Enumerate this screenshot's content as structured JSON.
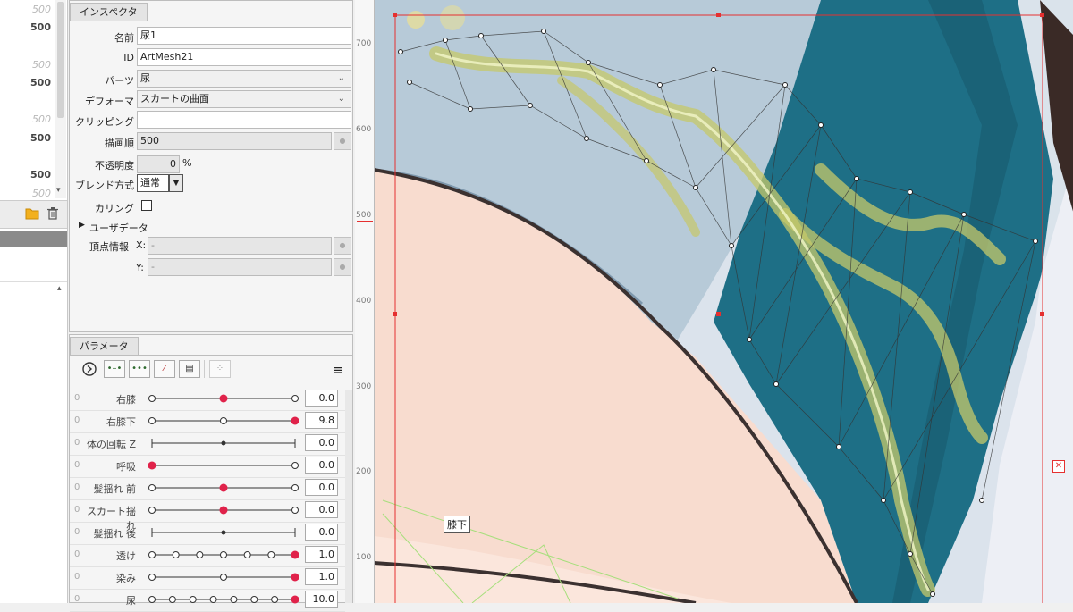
{
  "left_list": {
    "values": [
      {
        "text": "500",
        "style": "faded"
      },
      {
        "text": "500",
        "style": "solid"
      },
      {
        "text": "500",
        "style": "faded"
      },
      {
        "text": "500",
        "style": "solid"
      },
      {
        "text": "500",
        "style": "faded"
      },
      {
        "text": "500",
        "style": "solid"
      },
      {
        "text": "500",
        "style": "solid"
      },
      {
        "text": "500",
        "style": "faded"
      }
    ]
  },
  "inspector": {
    "tab_label": "インスペクタ",
    "name_label": "名前",
    "name_value": "尿1",
    "id_label": "ID",
    "id_value": "ArtMesh21",
    "parts_label": "パーツ",
    "parts_value": "尿",
    "deformer_label": "デフォーマ",
    "deformer_value": "スカートの曲面",
    "clipping_label": "クリッピング",
    "clipping_value": "",
    "draw_order_label": "描画順",
    "draw_order_value": "500",
    "opacity_label": "不透明度",
    "opacity_value": "0",
    "opacity_unit": "%",
    "blend_label": "ブレンド方式",
    "blend_value": "通常",
    "culling_label": "カリング",
    "culling_checked": false,
    "userdata_label": "ユーザデータ",
    "vertex_label": "頂点情報",
    "vx_label": "X:",
    "vx_value": "-",
    "vy_label": "Y:",
    "vy_value": "-"
  },
  "parameters": {
    "tab_label": "パラメータ",
    "rows": [
      {
        "name": "右膝",
        "value": "0.0",
        "keys": 3,
        "current": 0.5
      },
      {
        "name": "右膝下",
        "value": "9.8",
        "keys": 3,
        "current": 1.0
      },
      {
        "name": "体の回転 Z",
        "value": "0.0",
        "keys": 0,
        "current": 0.5
      },
      {
        "name": "呼吸",
        "value": "0.0",
        "keys": 2,
        "current": 0.0
      },
      {
        "name": "髪揺れ 前",
        "value": "0.0",
        "keys": 3,
        "current": 0.5
      },
      {
        "name": "スカート揺れ",
        "value": "0.0",
        "keys": 3,
        "current": 0.5
      },
      {
        "name": "髪揺れ 後",
        "value": "0.0",
        "keys": 0,
        "current": 0.5
      },
      {
        "name": "透け",
        "value": "1.0",
        "keys": 7,
        "current": 1.0
      },
      {
        "name": "染み",
        "value": "1.0",
        "keys": 3,
        "current": 1.0
      },
      {
        "name": "尿",
        "value": "10.0",
        "keys": 8,
        "current": 1.0
      }
    ]
  },
  "viewport": {
    "ruler_labels": [
      "700",
      "600",
      "500",
      "400",
      "300",
      "200",
      "100"
    ],
    "deformer_label": "膝下"
  },
  "colors": {
    "accent_red": "#e0224a",
    "selection_red": "#e53030",
    "panel_bg": "#f5f5f5"
  }
}
